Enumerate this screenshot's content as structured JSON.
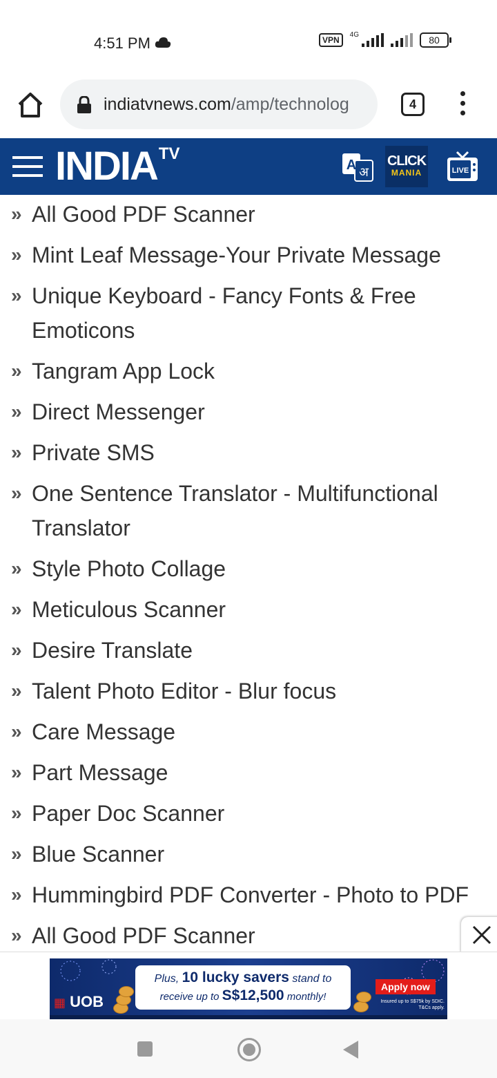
{
  "status_bar": {
    "time": "4:51 PM",
    "vpn": "VPN",
    "network": "4G",
    "battery": "80"
  },
  "browser": {
    "url_domain": "indiatvnews.com",
    "url_path": "/amp/technolog",
    "tab_count": "4"
  },
  "site_header": {
    "logo_text": "INDIA",
    "logo_suffix": "TV",
    "translate_label": "A अ",
    "click_mania_line1": "CLICK",
    "click_mania_line2": "MANIA",
    "live_label": "LIVE",
    "brand_color": "#0e3f84"
  },
  "article_list": [
    "All Good PDF Scanner",
    "Mint Leaf Message-Your Private Message",
    "Unique Keyboard - Fancy Fonts & Free Emoticons",
    "Tangram App Lock",
    "Direct Messenger",
    "Private SMS",
    "One Sentence Translator - Multifunctional Translator",
    "Style Photo Collage",
    "Meticulous Scanner",
    "Desire Translate",
    "Talent Photo Editor - Blur focus",
    "Care Message",
    "Part Message",
    "Paper Doc Scanner",
    "Blue Scanner",
    "Hummingbird PDF Converter - Photo to PDF",
    "All Good PDF Scanner"
  ],
  "ad": {
    "brand": "UOB",
    "line1_pre": "Plus, ",
    "line1_bold": "10 lucky savers",
    "line1_post": " stand to",
    "line2_pre": "receive up to ",
    "line2_bold": "S$12,500",
    "line2_post": " monthly!",
    "cta": "Apply now",
    "fineprint": "Insured up to S$75k by SDIC. T&Cs apply."
  },
  "nav_bar": {
    "icons": [
      "recent-apps-icon",
      "home-icon",
      "back-icon"
    ]
  }
}
